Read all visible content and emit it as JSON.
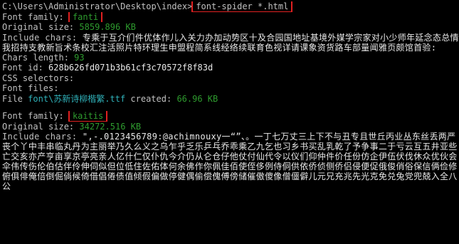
{
  "prompt": "C:\\Users\\Administrator\\Desktop\\index>",
  "command": "font-spider *.html",
  "labels": {
    "font_family": "Font family:",
    "original_size": "Original size:",
    "include_chars": "Include chars:",
    "chars_length": "Chars length:",
    "font_id": "Font id:",
    "css_selectors": "CSS selectors:",
    "font_files": "Font files:",
    "file": "File",
    "created": "created:"
  },
  "fonts": [
    {
      "family": "fanti",
      "original_size": "5859.896 KB",
      "include_chars": "专乘于互介们件优体作儿入关力办加动势区十及合园国地址基境外媒学宗家对小少师年延念态总情我招持支教新旨术条校汇注活照片特环理生申盟程简系线经络续联育色视详请课象资货路车部量闻雅页颇馆首验:",
      "chars_length": "93",
      "font_id": "628b626fd071b3b61cf3c70572f8f83d",
      "file_dir": "font\\",
      "file_name": "苏新诗柳楷繁.ttf",
      "created": "66.96 KB"
    },
    {
      "family": "kaitis",
      "original_size": "34272.516 KB",
      "include_chars": "\",-.0123456789:@achimnouxy一“”、。一丁七万丈三上下不与丑专且世丘丙业丛东丝丢两严丧个丫中丰串临丸丹为主丽举乃久么义之乌乍乎乏乐乒乓乔乖乘乙九乞也习乡书买乱乳乾了予争事二于亏云互五井亚些亡交亥亦产亨亩享京亭亮亲人亿什仁仅仆仇今介仍从仑仓仔他仗付仙代令以仪们仰仲件价任份仿企伊伍伏伐休众优伙会伞伟传伤伦伯估伴伶伸伺似但位低住佐佑体何余佛作你佩佳佰使侄侈例侍侗供依侨侦侧侨侣侵便促俄俊俏俗保信俩俭修俯俱俳俺倍倒倔倘候倚借倡倦债值倾假偏做停健偶偷偿傀傅傍储催傲傻像僧僵僻儿元兄充兆先光克免兑兔党兜兢入全八公"
    }
  ]
}
